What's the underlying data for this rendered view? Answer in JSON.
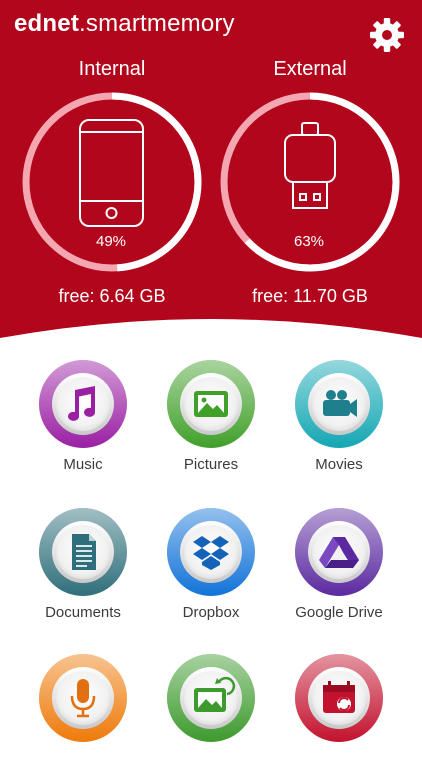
{
  "app": {
    "title_bold": "ednet",
    "title_rest": ".smartmemory"
  },
  "colors": {
    "brand_red": "#b2061c",
    "ring_track": "#f4a7b1",
    "ring_fill": "#ffffff"
  },
  "storage": [
    {
      "label": "Internal",
      "percent_text": "49%",
      "percent_used": 49,
      "free_text": "free: 6.64 GB",
      "icon": "smartphone-icon"
    },
    {
      "label": "External",
      "percent_text": "63%",
      "percent_used": 63,
      "free_text": "free: 11.70 GB",
      "icon": "usb-drive-icon"
    }
  ],
  "tiles": [
    {
      "label": "Music",
      "icon": "music-note-icon",
      "color": "#9a1fa3"
    },
    {
      "label": "Pictures",
      "icon": "image-icon",
      "color": "#41a02a"
    },
    {
      "label": "Movies",
      "icon": "video-camera-icon",
      "color": "#13a7b3"
    },
    {
      "label": "Documents",
      "icon": "document-icon",
      "color": "#2f6f7b"
    },
    {
      "label": "Dropbox",
      "icon": "dropbox-icon",
      "color": "#1273d8"
    },
    {
      "label": "Google Drive",
      "icon": "google-drive-icon",
      "color": "#5b2aa0"
    },
    {
      "label": "",
      "icon": "microphone-icon",
      "color": "#ef7a0a"
    },
    {
      "label": "",
      "icon": "image-sync-icon",
      "color": "#3d9a2d"
    },
    {
      "label": "",
      "icon": "calendar-sync-icon",
      "color": "#c3122d"
    }
  ]
}
